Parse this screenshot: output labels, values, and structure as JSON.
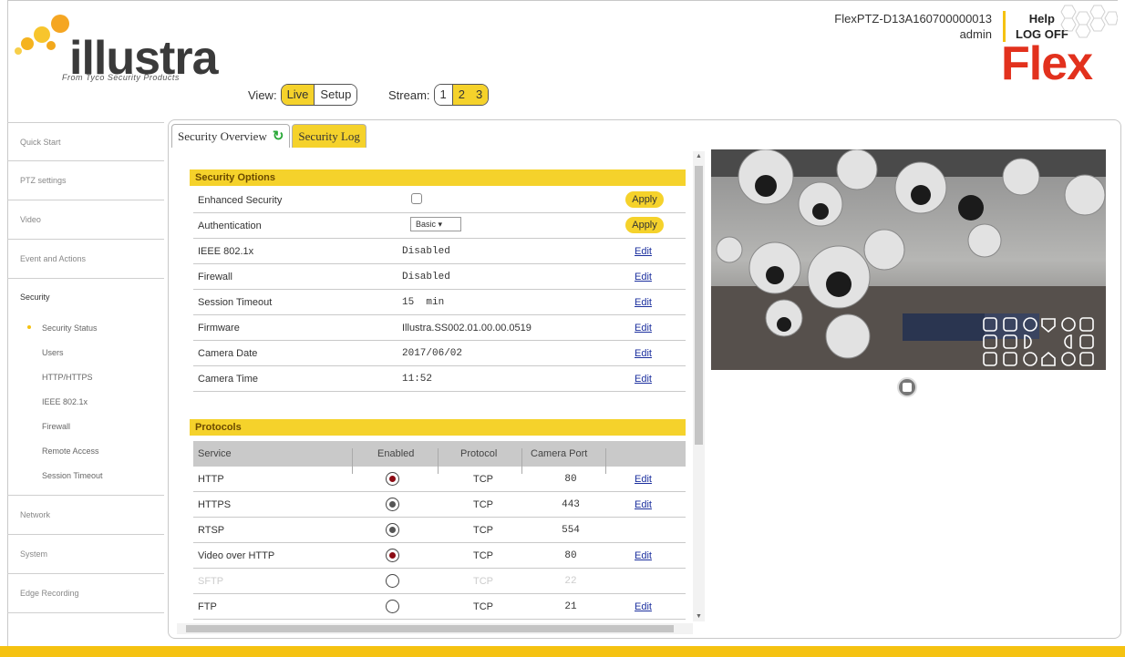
{
  "header": {
    "logo_text": "illustra",
    "logo_tagline": "From Tyco Security Products",
    "view_label": "View:",
    "view_live": "Live",
    "view_setup": "Setup",
    "stream_label": "Stream:",
    "streams": [
      "1",
      "2",
      "3"
    ],
    "device_name": "FlexPTZ-D13A160700000013",
    "user": "admin",
    "help": "Help",
    "logoff": "LOG OFF",
    "brand": "Flex"
  },
  "sidebar": {
    "items_top": [
      "Quick Start",
      "PTZ settings",
      "Video",
      "Event and Actions"
    ],
    "group_title": "Security",
    "sub_items": [
      "Security Status",
      "Users",
      "HTTP/HTTPS",
      "IEEE 802.1x",
      "Firewall",
      "Remote Access",
      "Session Timeout"
    ],
    "items_bottom": [
      "Network",
      "System",
      "Edge Recording"
    ]
  },
  "tabs": {
    "overview": "Security Overview",
    "log": "Security Log"
  },
  "security_options": {
    "title": "Security Options",
    "apply_label": "Apply",
    "edit_label": "Edit",
    "enhanced_label": "Enhanced Security",
    "enhanced_checked": false,
    "auth_label": "Authentication",
    "auth_value": "Basic",
    "rows": [
      {
        "label": "IEEE 802.1x",
        "value": "Disabled"
      },
      {
        "label": "Firewall",
        "value": "Disabled"
      },
      {
        "label": "Session Timeout",
        "value": "15  min"
      },
      {
        "label": "Firmware",
        "value": "Illustra.SS002.01.00.00.0519"
      },
      {
        "label": "Camera Date",
        "value": "2017/06/02"
      },
      {
        "label": "Camera Time",
        "value": "11:52"
      }
    ]
  },
  "protocols": {
    "title": "Protocols",
    "headers": [
      "Service",
      "Enabled",
      "Protocol",
      "Camera Port"
    ],
    "rows": [
      {
        "service": "HTTP",
        "protocol": "TCP",
        "port": "80",
        "edit": "Edit"
      },
      {
        "service": "HTTPS",
        "protocol": "TCP",
        "port": "443",
        "edit": "Edit"
      },
      {
        "service": "RTSP",
        "protocol": "TCP",
        "port": "554",
        "edit": ""
      },
      {
        "service": "Video over HTTP",
        "protocol": "TCP",
        "port": "80",
        "edit": "Edit"
      },
      {
        "service": "SFTP",
        "protocol": "TCP",
        "port": "22",
        "edit": ""
      },
      {
        "service": "FTP",
        "protocol": "TCP",
        "port": "21",
        "edit": "Edit"
      }
    ]
  },
  "colors": {
    "accent": "#f5d22b",
    "brand_red": "#e2311d",
    "radio_on": "#8c0c14"
  }
}
